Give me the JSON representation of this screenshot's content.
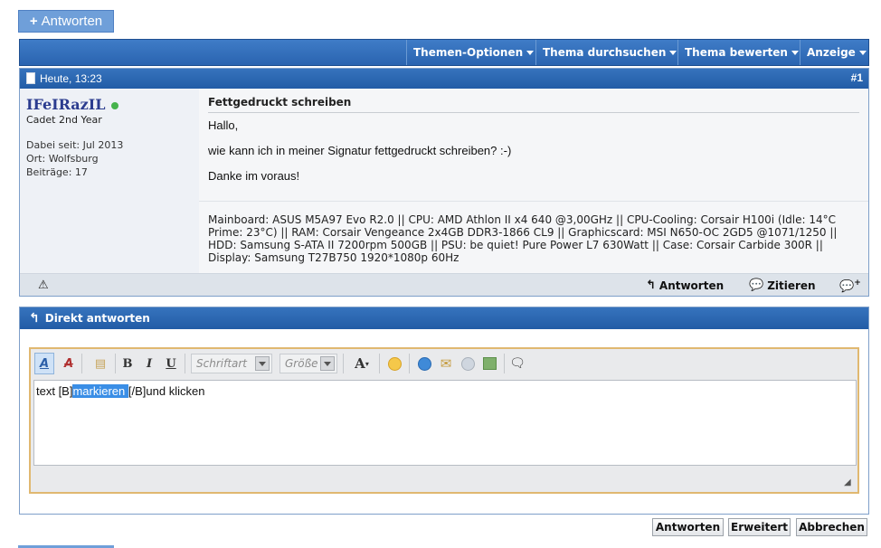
{
  "top_reply_button": {
    "label": "Antworten"
  },
  "toolbar": {
    "items": [
      {
        "label": "Themen-Optionen"
      },
      {
        "label": "Thema durchsuchen"
      },
      {
        "label": "Thema bewerten"
      },
      {
        "label": "Anzeige"
      }
    ]
  },
  "post": {
    "date": "Heute, 13:23",
    "number": "#1",
    "user": {
      "name": "IFeIRazIL",
      "title": "Cadet 2nd Year",
      "joined": "Dabei seit: Jul 2013",
      "location": "Ort: Wolfsburg",
      "posts": "Beiträge: 17"
    },
    "title": "Fettgedruckt schreiben",
    "body": [
      "Hallo,",
      "wie kann ich in meiner Signatur fettgedruckt schreiben? :-)",
      "Danke im voraus!"
    ],
    "signature": "Mainboard: ASUS M5A97 Evo R2.0 || CPU: AMD Athlon II x4 640 @3,00GHz || CPU-Cooling: Corsair H100i (Idle: 14°C Prime: 23°C) || RAM: Corsair Vengeance 2x4GB DDR3-1866 CL9 || Graphicscard: MSI N650-OC 2GD5 @1071/1250 || HDD: Samsung S-ATA II 7200rpm 500GB || PSU: be quiet! Pure Power L7 630Watt || Case: Corsair Carbide 300R || Display: Samsung T27B750 1920*1080p 60Hz",
    "footer": {
      "reply": "Antworten",
      "quote": "Zitieren"
    }
  },
  "quick_reply": {
    "title": "Direkt antworten",
    "font_placeholder": "Schriftart",
    "size_placeholder": "Größe",
    "text_before": "text [B]",
    "text_selected": "markieren ",
    "text_after": "[/B]und klicken"
  },
  "buttons": {
    "submit": "Antworten",
    "advanced": "Erweitert",
    "cancel": "Abbrechen"
  }
}
